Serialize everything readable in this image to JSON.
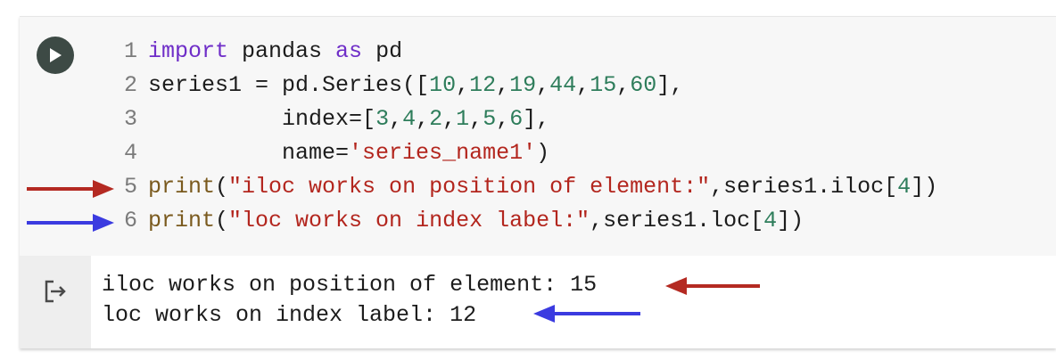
{
  "cell": {
    "run_icon": "play-icon",
    "output_icon": "output-exit-icon",
    "line_numbers": [
      "1",
      "2",
      "3",
      "4",
      "5",
      "6"
    ],
    "code": {
      "l1": {
        "kw1": "import",
        "rest1": " pandas ",
        "kw2": "as",
        "rest2": " pd"
      },
      "l2": {
        "a": "series1 = pd.Series([",
        "n1": "10",
        "c1": ",",
        "n2": "12",
        "c2": ",",
        "n3": "19",
        "c3": ",",
        "n4": "44",
        "c4": ",",
        "n5": "15",
        "c5": ",",
        "n6": "60",
        "b": "],"
      },
      "l3": {
        "indent": "          ",
        "a": "index=[",
        "n1": "3",
        "c1": ",",
        "n2": "4",
        "c2": ",",
        "n3": "2",
        "c3": ",",
        "n4": "1",
        "c4": ",",
        "n5": "5",
        "c5": ",",
        "n6": "6",
        "b": "],"
      },
      "l4": {
        "indent": "          ",
        "a": "name=",
        "s": "'series_name1'",
        "b": ")"
      },
      "l5": {
        "fn": "print",
        "p": "(",
        "s": "\"iloc works on position of element:\"",
        "a": ",series1.iloc[",
        "n": "4",
        "b": "])"
      },
      "l6": {
        "fn": "print",
        "p": "(",
        "s": "\"loc works on index label:\"",
        "a": ",series1.loc[",
        "n": "4",
        "b": "])"
      }
    },
    "output_lines": [
      "iloc works on position of element: 15",
      "loc works on index label: 12"
    ]
  },
  "annotations": {
    "red": "#b42a22",
    "blue": "#3b3be0"
  }
}
